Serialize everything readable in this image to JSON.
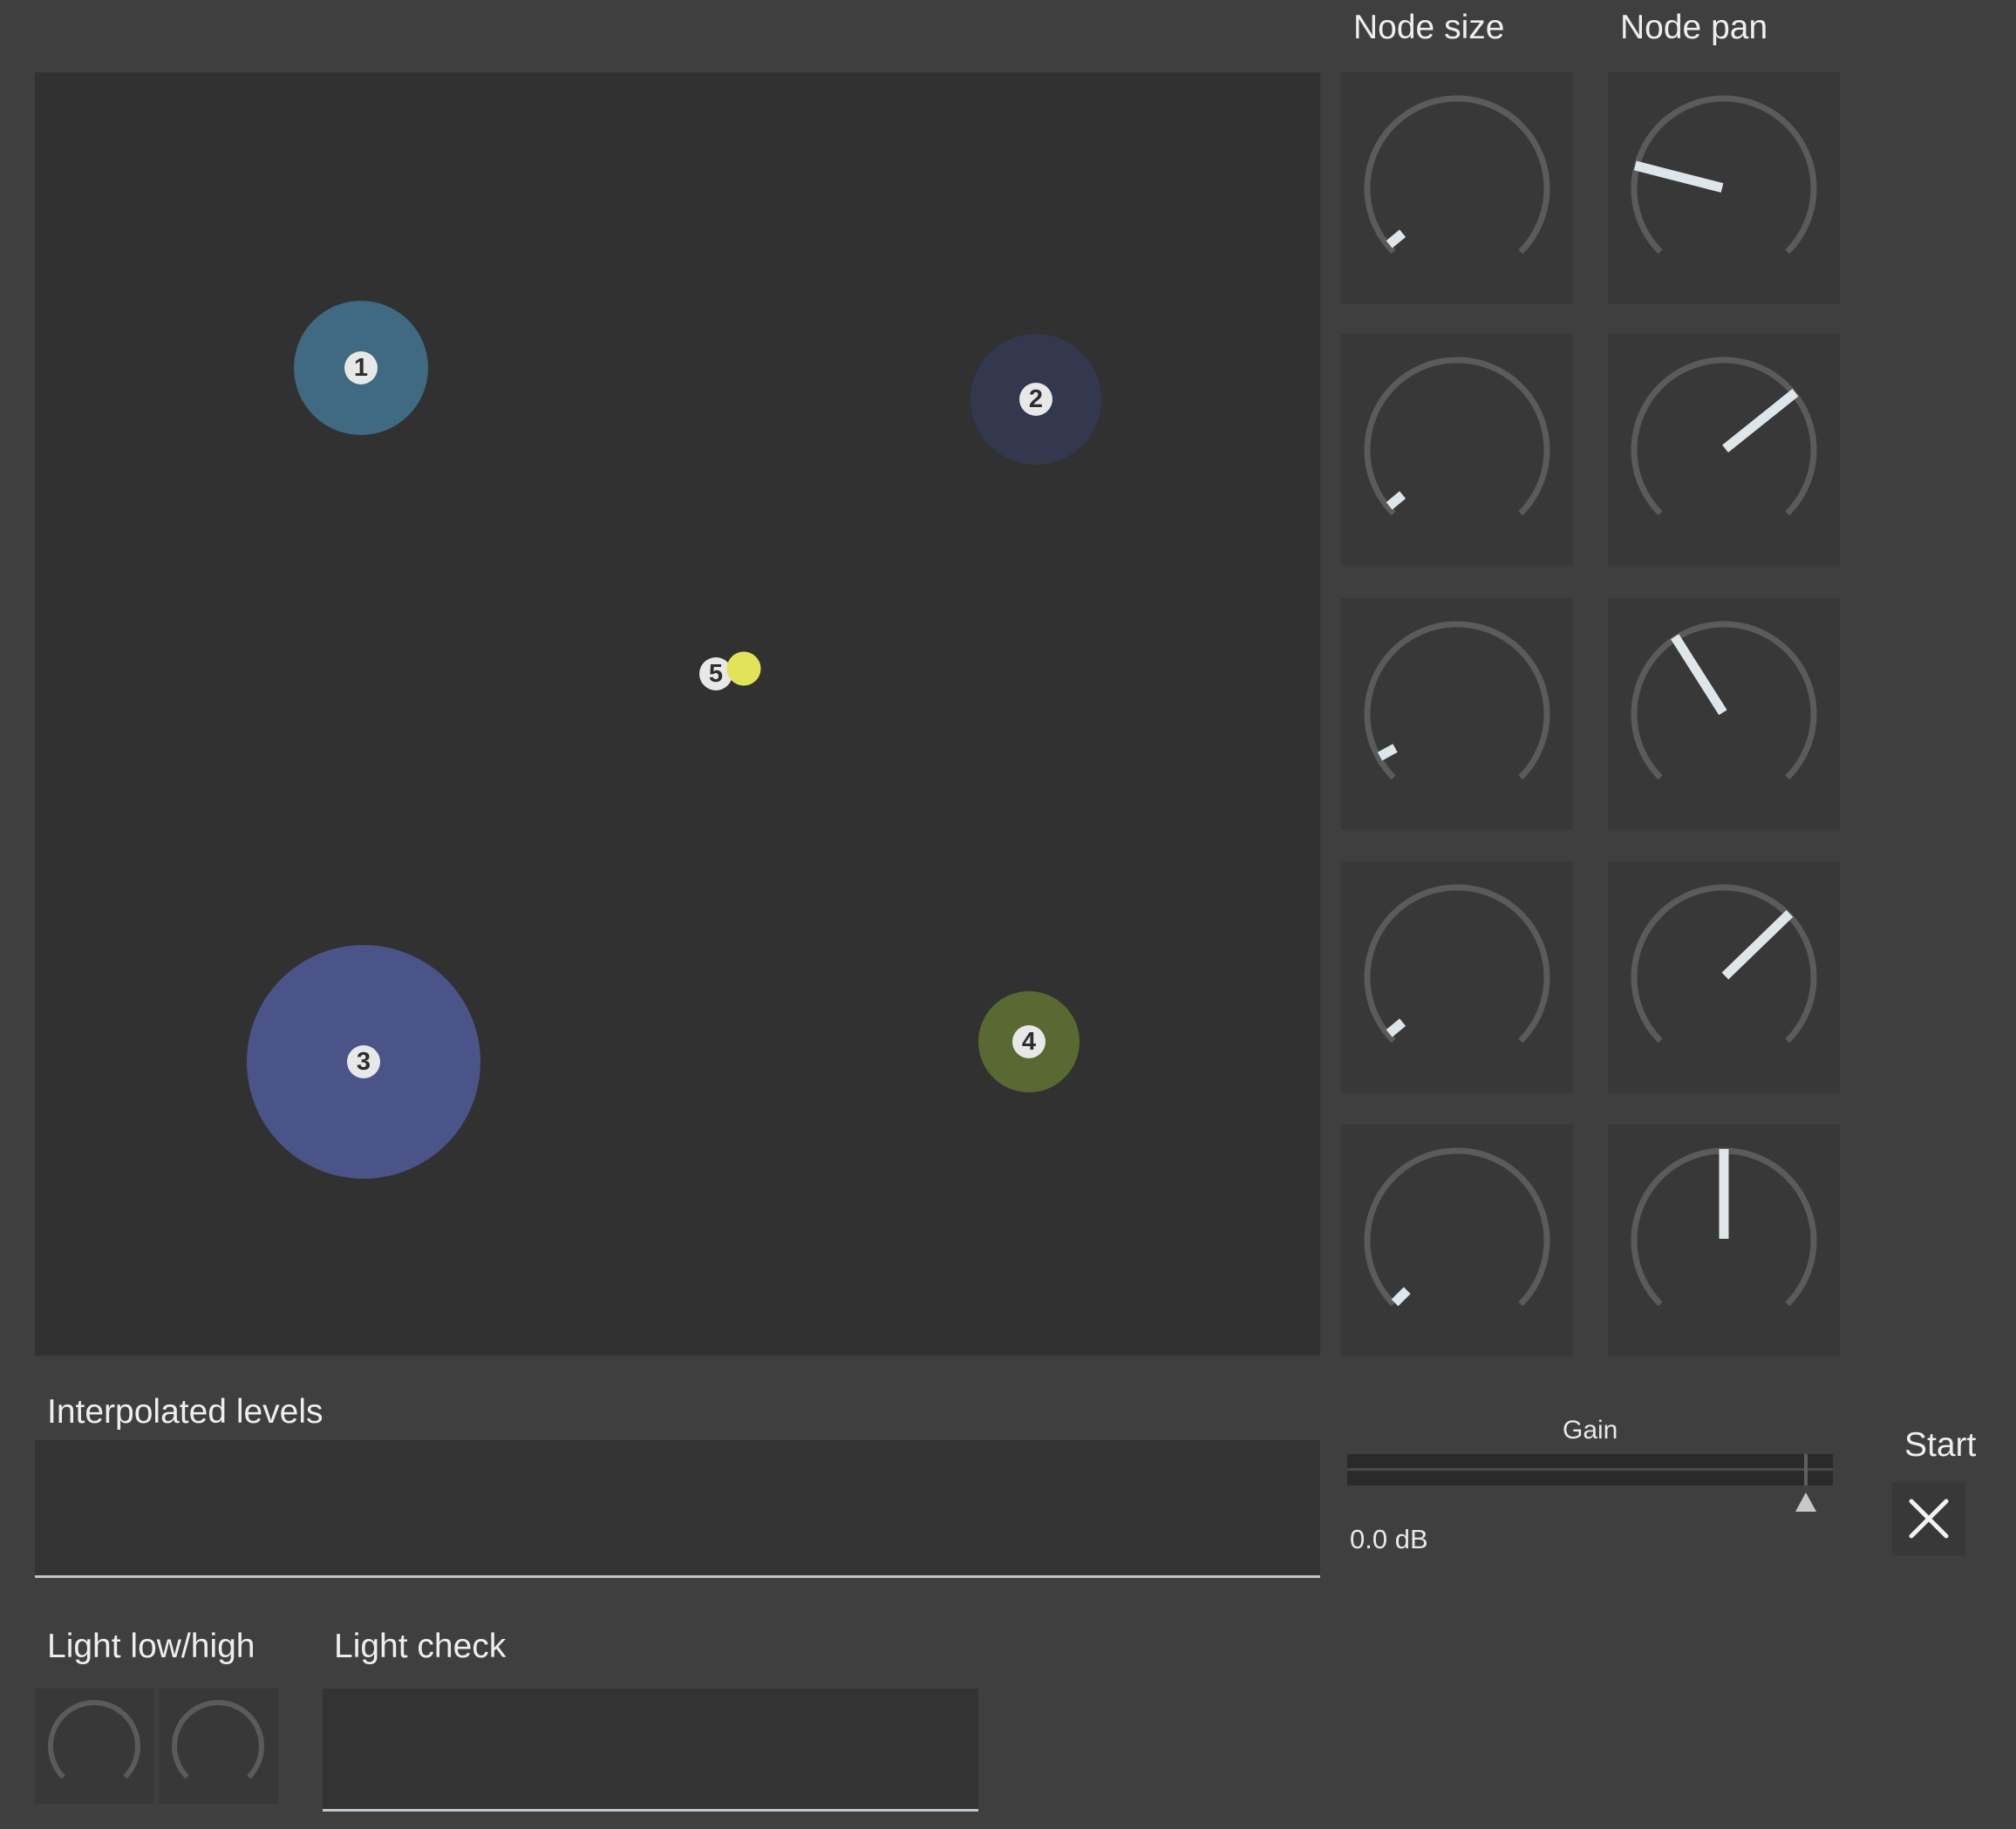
{
  "labels": {
    "node_size": "Node size",
    "node_pan": "Node pan",
    "interpolated_levels": "Interpolated levels",
    "light_low_high": "Light low/high",
    "light_check": "Light check",
    "gain": "Gain",
    "start": "Start"
  },
  "gain": {
    "value_text": "0.0 dB",
    "position": 0.945
  },
  "nodes": [
    {
      "id": "1",
      "color": "#3f6a82",
      "size": 0.2
    },
    {
      "id": "2",
      "color": "#33384f",
      "size": 0.2
    },
    {
      "id": "3",
      "color": "#4b5489",
      "size": 0.35
    },
    {
      "id": "4",
      "color": "#5a6931",
      "size": 0.15
    },
    {
      "id": "5",
      "color": "#e3e35a",
      "size": 0.03
    }
  ],
  "node_size_knobs": [
    0.02,
    0.02,
    0.06,
    0.02,
    0.0
  ],
  "node_pan_knobs": [
    0.22,
    0.69,
    0.38,
    0.67,
    0.5
  ],
  "light_low_high_knobs": [
    0.0,
    0.0
  ],
  "start_button_icon": "close-icon"
}
